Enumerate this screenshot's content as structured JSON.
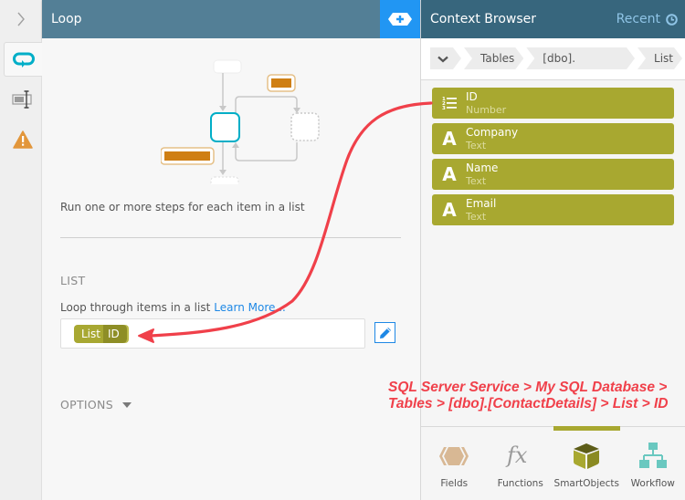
{
  "loop_panel": {
    "title": "Loop",
    "add_button_icon": "add-step-icon",
    "description": "Run one or more steps for each item in a list",
    "list_section": {
      "title": "LIST",
      "label": "Loop through items in a list",
      "learn_more": "Learn More...",
      "token": {
        "source": "List",
        "field": "ID"
      },
      "edit_icon": "pencil-icon"
    },
    "options_label": "OPTIONS"
  },
  "rail": {
    "toggle_icon": "chevron-right-icon",
    "tabs": [
      {
        "icon": "loop-icon",
        "active": true
      },
      {
        "icon": "input-field-icon",
        "active": false
      },
      {
        "icon": "warning-icon",
        "active": false
      }
    ]
  },
  "context_browser": {
    "title": "Context Browser",
    "recent_label": "Recent",
    "breadcrumbs": [
      "Tables",
      "[dbo].[Contact...",
      "List"
    ],
    "fields": [
      {
        "name": "ID",
        "type": "Number",
        "icon": "numbered-list-icon"
      },
      {
        "name": "Company",
        "type": "Text",
        "icon": "text-icon"
      },
      {
        "name": "Name",
        "type": "Text",
        "icon": "text-icon"
      },
      {
        "name": "Email",
        "type": "Text",
        "icon": "text-icon"
      }
    ],
    "bottom_tabs": [
      {
        "label": "Fields",
        "icon": "fields-icon",
        "active": false
      },
      {
        "label": "Functions",
        "icon": "fx-icon",
        "active": false
      },
      {
        "label": "SmartObjects",
        "icon": "cube-icon",
        "active": true
      },
      {
        "label": "Workflow",
        "icon": "workflow-icon",
        "active": false
      }
    ],
    "accent_color": "#a8a830"
  },
  "annotation": {
    "text": "SQL Server Service > My SQL Database >\nTables > [dbo].[ContactDetails] > List > ID",
    "color": "#f0404a"
  }
}
